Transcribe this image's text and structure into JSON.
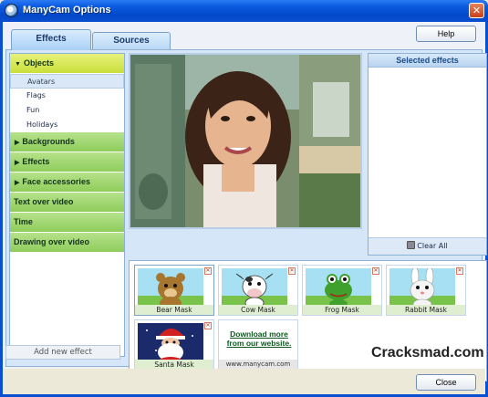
{
  "window": {
    "title": "ManyCam Options"
  },
  "tabs": [
    {
      "label": "Effects"
    },
    {
      "label": "Sources"
    }
  ],
  "buttons": {
    "help": "Help",
    "close": "Close",
    "add_new_effect": "Add new effect"
  },
  "categories": {
    "objects": {
      "label": "Objects",
      "subitems": [
        "Avatars",
        "Flags",
        "Fun",
        "Holidays"
      ]
    },
    "backgrounds": "Backgrounds",
    "effects": "Effects",
    "face_accessories": "Face accessories",
    "text_over_video": "Text over video",
    "time": "Time",
    "drawing_over_video": "Drawing over video"
  },
  "selected_effects": {
    "header": "Selected effects",
    "clear_all": "Clear All"
  },
  "effects_grid": [
    {
      "label": "Bear Mask"
    },
    {
      "label": "Cow Mask"
    },
    {
      "label": "Frog Mask"
    },
    {
      "label": "Rabbit Mask"
    },
    {
      "label": "Santa Mask"
    }
  ],
  "download_tile": {
    "text": "Download more from our website.",
    "site": "www.manycam.com"
  },
  "watermark": "Cracksmad.com",
  "colors": {
    "titlebar": "#0a5ae0",
    "category_green": "#8fcc5b",
    "category_active": "#c9df3a",
    "panel_blue": "#d4e6f8"
  }
}
